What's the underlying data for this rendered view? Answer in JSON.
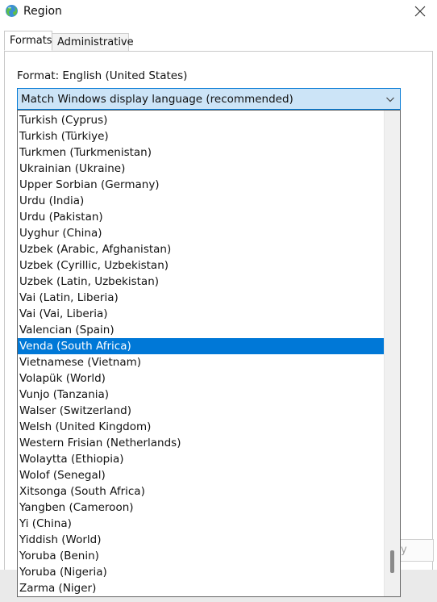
{
  "window": {
    "title": "Region"
  },
  "tabs": [
    {
      "label": "Formats",
      "selected": true
    },
    {
      "label": "Administrative",
      "selected": false
    }
  ],
  "format": {
    "label": "Format: English (United States)",
    "selected_value": "Match Windows display language (recommended)"
  },
  "dropdown": {
    "items": [
      "Turkish (Cyprus)",
      "Turkish (Türkiye)",
      "Turkmen (Turkmenistan)",
      "Ukrainian (Ukraine)",
      "Upper Sorbian (Germany)",
      "Urdu (India)",
      "Urdu (Pakistan)",
      "Uyghur (China)",
      "Uzbek (Arabic, Afghanistan)",
      "Uzbek (Cyrillic, Uzbekistan)",
      "Uzbek (Latin, Uzbekistan)",
      "Vai (Latin, Liberia)",
      "Vai (Vai, Liberia)",
      "Valencian (Spain)",
      "Venda (South Africa)",
      "Vietnamese (Vietnam)",
      "Volapük (World)",
      "Vunjo (Tanzania)",
      "Walser (Switzerland)",
      "Welsh (United Kingdom)",
      "Western Frisian (Netherlands)",
      "Wolaytta (Ethiopia)",
      "Wolof (Senegal)",
      "Xitsonga (South Africa)",
      "Yangben (Cameroon)",
      "Yi (China)",
      "Yiddish (World)",
      "Yoruba (Benin)",
      "Yoruba (Nigeria)",
      "Zarma (Niger)"
    ],
    "highlighted_index": 14,
    "scroll_position": 0.97
  },
  "behind_button": {
    "label": "y"
  },
  "icons": {
    "app": "globe-icon",
    "close": "close-icon",
    "dropdown": "chevron-down-icon"
  },
  "colors": {
    "accent": "#0078d7",
    "combo_fill": "#cce4f7",
    "combo_border": "#0078d4"
  }
}
